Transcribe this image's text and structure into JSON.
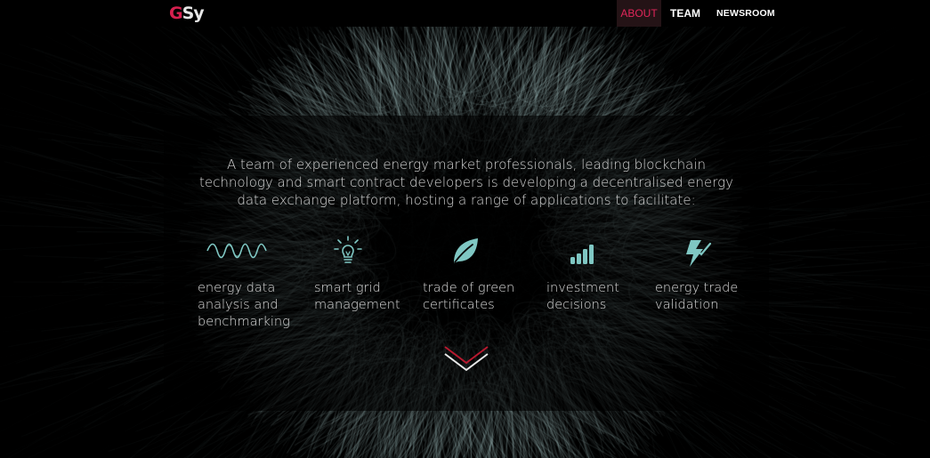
{
  "header": {
    "logo": {
      "part1": "G",
      "part2": "Sy"
    },
    "nav": [
      {
        "label": "ABOUT",
        "active": true
      },
      {
        "label": "TEAM",
        "active": false
      },
      {
        "label": "NEWSROOM",
        "active": false
      }
    ]
  },
  "intro": {
    "text": "A team of experienced energy market professionals, leading blockchain technology and smart contract developers is developing a decentralised energy data exchange platform, hosting a range of applications to facilitate:"
  },
  "features": [
    {
      "icon": "waveform-icon",
      "label": "energy data\nanalysis and\nbenchmarking"
    },
    {
      "icon": "lightbulb-icon",
      "label": "smart grid\nmanagement"
    },
    {
      "icon": "leaf-icon",
      "label": "trade of green\ncertificates"
    },
    {
      "icon": "bar-chart-icon",
      "label": "investment\ndecisions"
    },
    {
      "icon": "lightning-check-icon",
      "label": "energy trade\nvalidation"
    }
  ],
  "colors": {
    "accent_red": "#d6204f",
    "icon_teal": "#7fc7c3",
    "background": "#000000"
  },
  "scroll_indicator": {
    "icon": "chevron-down-icon"
  }
}
